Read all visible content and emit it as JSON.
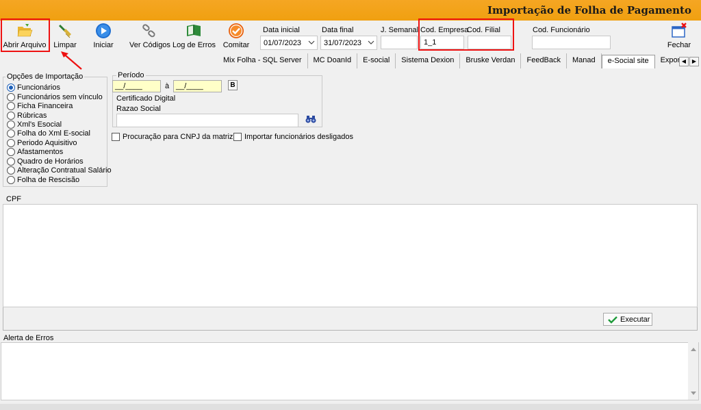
{
  "window": {
    "title": "Importação de Folha de Pagamento"
  },
  "toolbar": {
    "open_label": "Abrir Arquivo",
    "clear_label": "Limpar",
    "start_label": "Iniciar",
    "codes_label": "Ver Códigos",
    "errors_label": "Log de Erros",
    "commit_label": "Comitar",
    "close_label": "Fechar"
  },
  "filters": {
    "start_date_label": "Data inicial",
    "start_date": "01/07/2023",
    "end_date_label": "Data final",
    "end_date": "31/07/2023",
    "weekly_label": "J. Semanal",
    "weekly_value": "",
    "company_label": "Cod. Empresa",
    "company_value": "1_1",
    "branch_label": "Cod. Filial",
    "branch_value": "",
    "employee_label": "Cod. Funcionário",
    "employee_value": ""
  },
  "tabs": [
    "Mix Folha - SQL Server",
    "MC DoanId",
    "E-social",
    "Sistema Dexion",
    "Bruske Verdan",
    "FeedBack",
    "Manad",
    "e-Social site",
    "Exporta"
  ],
  "active_tab": "e-Social site",
  "import_options": {
    "title": "Opções de Importação",
    "items": [
      "Funcionários",
      "Funcionários sem vínculo",
      "Ficha Financeira",
      "Rúbricas",
      "Xml's Esocial",
      "Folha do Xml E-social",
      "Periodo Aquisitivo",
      "Afastamentos",
      "Quadro de Horários",
      "Alteração Contratual Salário",
      "Folha de Rescisão"
    ],
    "selected": "Funcionários"
  },
  "period": {
    "title": "Período",
    "from": "__/____",
    "separator": "à",
    "to": "__/____",
    "button": "B"
  },
  "certificate": {
    "title": "Certificado Digital",
    "company_name_label": "Razao Social",
    "company_name_value": ""
  },
  "options": {
    "proxy_label": "Procuração para CNPJ da matriz",
    "dismissed_label": "Importar funcionários desligados"
  },
  "cpf": {
    "label": "CPF"
  },
  "execute": {
    "label": "Executar"
  },
  "errors": {
    "label": "Alerta de Erros"
  },
  "colors": {
    "titlebar": "#f5a623",
    "highlight": "#e11111",
    "masked_field": "#ffffc8"
  }
}
